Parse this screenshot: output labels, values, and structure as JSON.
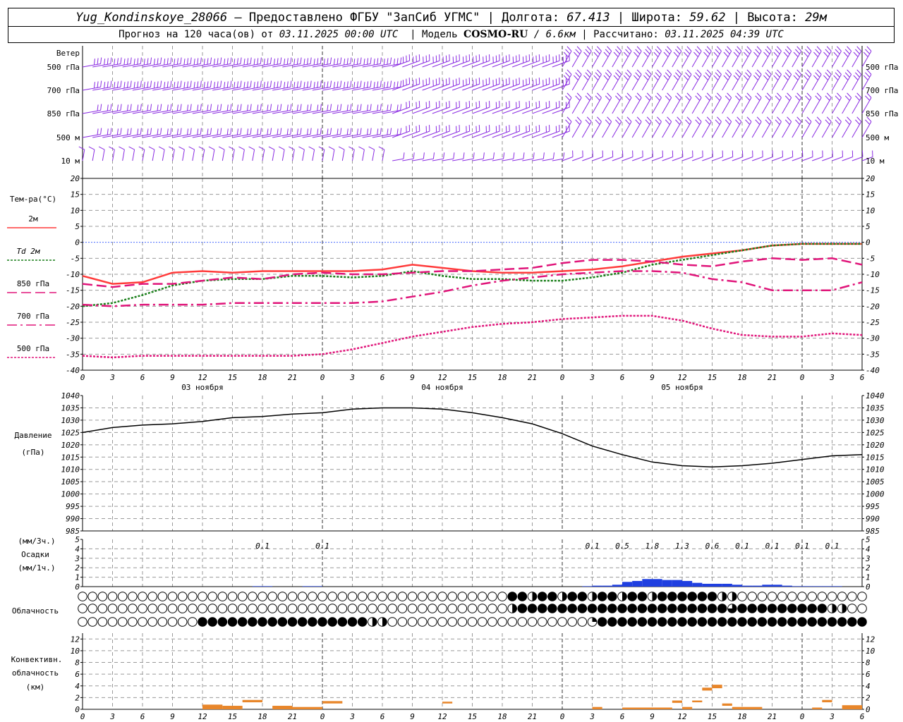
{
  "header": {
    "station": "Yug_Kondinskoye_28066",
    "provided": "– Предоставлено ФГБУ \"ЗапСиб УГМС\"",
    "lon_label": "Долгота:",
    "lon": "67.413",
    "lat_label": "Широта:",
    "lat": "59.62",
    "alt_label": "Высота:",
    "alt": "29м",
    "forecast_label": "Прогноз на 120 часа(ов) от",
    "forecast_from": "03.11.2025 00:00 UTC",
    "model_label": "Модель",
    "model": "COSMO-RU",
    "resolution": "/ 6.6км",
    "computed_label": "Рассчитано:",
    "computed": "03.11.2025 04:39 UTC"
  },
  "time_axis": {
    "tick_labels": [
      "0",
      "3",
      "6",
      "9",
      "12",
      "15",
      "18",
      "21",
      "0",
      "3",
      "6",
      "9",
      "12",
      "15",
      "18",
      "21",
      "0",
      "3",
      "6",
      "9",
      "12",
      "15",
      "18",
      "21",
      "0",
      "3",
      "6"
    ],
    "day_labels": [
      "03 ноября",
      "04 ноября",
      "05 ноября"
    ]
  },
  "wind_panel": {
    "title": "Ветер",
    "levels": [
      "500 гПа",
      "700 гПа",
      "850 гПа",
      "500 м",
      "10 м"
    ],
    "barb_color": "#8a2be2"
  },
  "temp_panel": {
    "title": "Тем-ра(°C)",
    "legend": [
      {
        "label": "2м",
        "color": "#ff3b3b",
        "style": "solid"
      },
      {
        "label": "Td 2м",
        "color": "#1a7f1a",
        "style": "dotted"
      },
      {
        "label": "850 гПа",
        "color": "#e0157a",
        "style": "dashed"
      },
      {
        "label": "700 гПа",
        "color": "#e0157a",
        "style": "dashdot"
      },
      {
        "label": "500 гПа",
        "color": "#e0157a",
        "style": "dotted"
      }
    ],
    "yticks": [
      "20",
      "15",
      "10",
      "5",
      "0",
      "-5",
      "-10",
      "-15",
      "-20",
      "-25",
      "-30",
      "-35",
      "-40"
    ],
    "zero_line_color": "#4a6cff"
  },
  "pressure_panel": {
    "title": "Давление",
    "unit": "(гПа)",
    "yticks": [
      "1040",
      "1035",
      "1030",
      "1025",
      "1020",
      "1015",
      "1010",
      "1005",
      "1000",
      "995",
      "990",
      "985"
    ]
  },
  "precip_panel": {
    "unit_top": "(мм/3ч.)",
    "title": "Осадки",
    "unit_bottom": "(мм/1ч.)",
    "yticks": [
      "5",
      "4",
      "3",
      "2",
      "1",
      "0"
    ],
    "labels_3h": [
      {
        "t": 18,
        "v": "0.1"
      },
      {
        "t": 24,
        "v": "0.1"
      },
      {
        "t": 51,
        "v": "0.1"
      },
      {
        "t": 54,
        "v": "0.5"
      },
      {
        "t": 57,
        "v": "1.8"
      },
      {
        "t": 60,
        "v": "1.3"
      },
      {
        "t": 63,
        "v": "0.6"
      },
      {
        "t": 66,
        "v": "0.1"
      },
      {
        "t": 69,
        "v": "0.1"
      },
      {
        "t": 72,
        "v": "0.1"
      },
      {
        "t": 75,
        "v": "0.1"
      }
    ],
    "bar_color": "#1f3fe0"
  },
  "cloud_panel": {
    "title": "Облачность"
  },
  "convective_panel": {
    "title_line1": "Конвективн.",
    "title_line2": "облачность",
    "unit": "(км)",
    "yticks": [
      "12",
      "10",
      "8",
      "6",
      "4",
      "2",
      "0"
    ],
    "bar_color": "#e8862a"
  },
  "chart_data": [
    {
      "type": "line",
      "title": "Тем-ра(°C)",
      "x_unit": "hours from 03.11.2025 00:00 UTC",
      "ylim": [
        -40,
        20
      ],
      "x": [
        0,
        3,
        6,
        9,
        12,
        15,
        18,
        21,
        24,
        27,
        30,
        33,
        36,
        39,
        42,
        45,
        48,
        51,
        54,
        57,
        60,
        63,
        66,
        69,
        72,
        75,
        78
      ],
      "series": [
        {
          "name": "2м",
          "values": [
            -10.5,
            -13,
            -12.5,
            -9.5,
            -9,
            -9.5,
            -9,
            -9,
            -9,
            -9,
            -8.5,
            -7,
            -8,
            -9,
            -9.5,
            -9.5,
            -9,
            -8.5,
            -7.5,
            -6,
            -4.5,
            -3.5,
            -2.5,
            -1,
            -0.5,
            -0.5,
            -0.5
          ]
        },
        {
          "name": "Td 2м",
          "values": [
            -20,
            -19,
            -16.5,
            -13.5,
            -12,
            -11.5,
            -11.5,
            -10.5,
            -10.5,
            -11,
            -10.5,
            -9,
            -10.5,
            -11.5,
            -11.5,
            -12,
            -12,
            -11,
            -9.5,
            -7,
            -5.5,
            -4,
            -2.5,
            -1,
            -0.5,
            -0.5,
            -0.5
          ]
        },
        {
          "name": "850 гПа",
          "values": [
            -13,
            -14,
            -13,
            -13,
            -12,
            -11,
            -11.5,
            -10,
            -9.5,
            -10,
            -10,
            -9.5,
            -9,
            -9,
            -8.5,
            -8,
            -6.5,
            -5.5,
            -5.5,
            -6,
            -7,
            -7.5,
            -6,
            -5,
            -5.5,
            -5,
            -7
          ]
        },
        {
          "name": "700 гПа",
          "values": [
            -19.5,
            -20,
            -19.5,
            -19.5,
            -19.5,
            -19,
            -19,
            -19,
            -19,
            -19,
            -18.5,
            -17,
            -15.5,
            -13.5,
            -12,
            -11,
            -10,
            -9.5,
            -9,
            -9,
            -9.5,
            -11.5,
            -12.5,
            -15,
            -15,
            -15,
            -12.5
          ]
        },
        {
          "name": "500 гПа",
          "values": [
            -35.5,
            -36,
            -35.5,
            -35.5,
            -35.5,
            -35.5,
            -35.5,
            -35.5,
            -35,
            -33.5,
            -31.5,
            -29.5,
            -28,
            -26.5,
            -25.5,
            -25,
            -24,
            -23.5,
            -23,
            -23,
            -24.5,
            -27,
            -29,
            -29.5,
            -29.5,
            -28.5,
            -29
          ]
        }
      ]
    },
    {
      "type": "line",
      "title": "Давление",
      "ylabel": "(гПа)",
      "ylim": [
        985,
        1040
      ],
      "x": [
        0,
        3,
        6,
        9,
        12,
        15,
        18,
        21,
        24,
        27,
        30,
        33,
        36,
        39,
        42,
        45,
        48,
        51,
        54,
        57,
        60,
        63,
        66,
        69,
        72,
        75,
        78
      ],
      "series": [
        {
          "values": [
            1025,
            1027,
            1028,
            1028.5,
            1029.5,
            1031,
            1031.5,
            1032.5,
            1033,
            1034.5,
            1035,
            1035,
            1034.5,
            1033,
            1031,
            1028.5,
            1024.5,
            1019.5,
            1016,
            1013,
            1011.5,
            1011,
            1011.5,
            1012.5,
            1014,
            1015.5,
            1016
          ]
        }
      ]
    },
    {
      "type": "bar",
      "title": "Осадки",
      "ylabel": "(мм/1ч.)",
      "ylim": [
        0,
        5
      ],
      "x": [
        17,
        18,
        22,
        23,
        50,
        51,
        52,
        53,
        54,
        55,
        56,
        57,
        58,
        59,
        60,
        61,
        62,
        63,
        64,
        65,
        66,
        67,
        68,
        69,
        70,
        71,
        72,
        73,
        74,
        75
      ],
      "values": [
        0.05,
        0.05,
        0.05,
        0.05,
        0.05,
        0.1,
        0.1,
        0.2,
        0.5,
        0.6,
        0.8,
        0.8,
        0.7,
        0.7,
        0.6,
        0.4,
        0.3,
        0.3,
        0.3,
        0.2,
        0.1,
        0.1,
        0.2,
        0.2,
        0.1,
        0.05,
        0.05,
        0.05,
        0.05,
        0.05
      ]
    },
    {
      "type": "bar",
      "title": "Конвективн. облачность",
      "ylabel": "(км)",
      "ylim": [
        0,
        13
      ],
      "bars": [
        {
          "t0": 12,
          "t1": 14,
          "base": 0,
          "top": 0.8
        },
        {
          "t0": 14,
          "t1": 16,
          "base": 0,
          "top": 0.6
        },
        {
          "t0": 16,
          "t1": 18,
          "base": 1.2,
          "top": 1.6
        },
        {
          "t0": 19,
          "t1": 21,
          "base": 0,
          "top": 0.6
        },
        {
          "t0": 21,
          "t1": 24,
          "base": 0,
          "top": 0.4
        },
        {
          "t0": 24,
          "t1": 26,
          "base": 1.0,
          "top": 1.4
        },
        {
          "t0": 36,
          "t1": 37,
          "base": 1.0,
          "top": 1.3
        },
        {
          "t0": 51,
          "t1": 52,
          "base": 0,
          "top": 0.4
        },
        {
          "t0": 54,
          "t1": 59,
          "base": 0,
          "top": 0.3
        },
        {
          "t0": 59,
          "t1": 60,
          "base": 1.1,
          "top": 1.5
        },
        {
          "t0": 60,
          "t1": 61,
          "base": 0,
          "top": 0.4
        },
        {
          "t0": 61,
          "t1": 62,
          "base": 1.2,
          "top": 1.5
        },
        {
          "t0": 62,
          "t1": 63,
          "base": 3.2,
          "top": 3.7
        },
        {
          "t0": 63,
          "t1": 64,
          "base": 3.6,
          "top": 4.2
        },
        {
          "t0": 64,
          "t1": 65,
          "base": 0.6,
          "top": 1.0
        },
        {
          "t0": 65,
          "t1": 68,
          "base": 0,
          "top": 0.4
        },
        {
          "t0": 73,
          "t1": 74,
          "base": 0,
          "top": 0.3
        },
        {
          "t0": 74,
          "t1": 75,
          "base": 1.2,
          "top": 1.6
        },
        {
          "t0": 76,
          "t1": 78,
          "base": 0,
          "top": 0.7
        }
      ]
    }
  ]
}
